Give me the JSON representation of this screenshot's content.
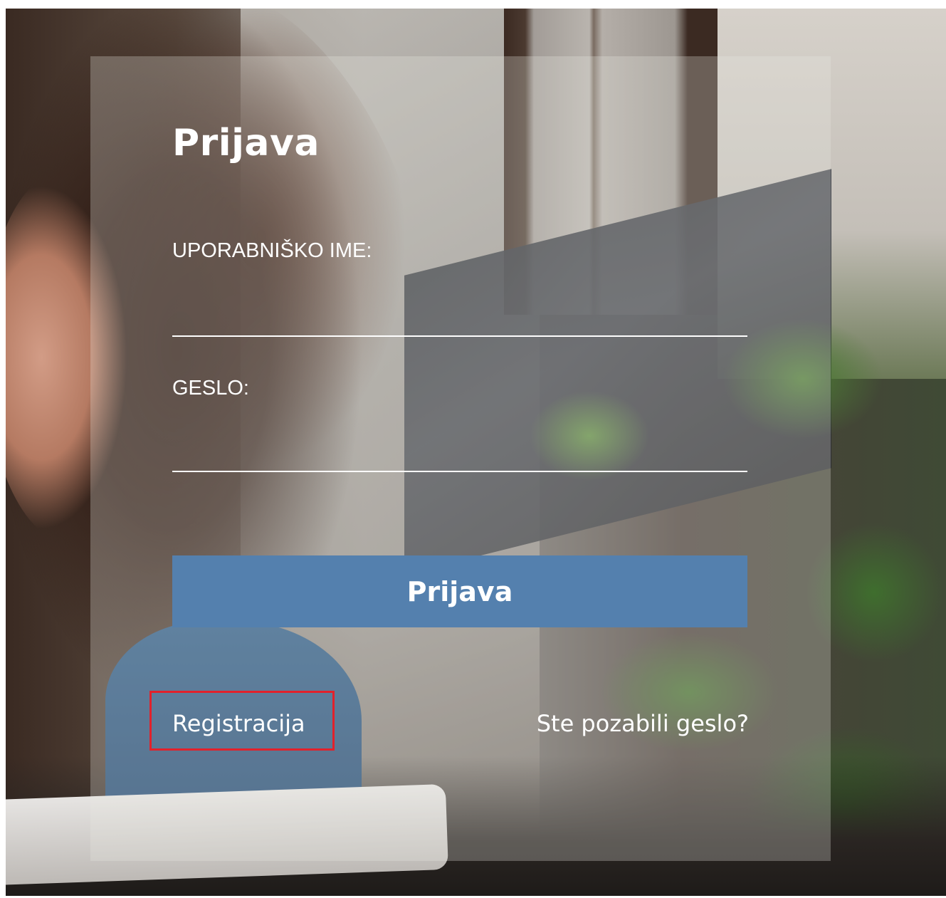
{
  "login": {
    "title": "Prijava",
    "username_label": "UPORABNIŠKO IME:",
    "username_value": "",
    "password_label": "GESLO:",
    "password_value": "",
    "submit_label": "Prijava",
    "register_link": "Registracija",
    "forgot_link": "Ste pozabili geslo?"
  },
  "colors": {
    "button_background": "#5480ae",
    "text": "#ffffff",
    "highlight_border": "#e2212b"
  }
}
